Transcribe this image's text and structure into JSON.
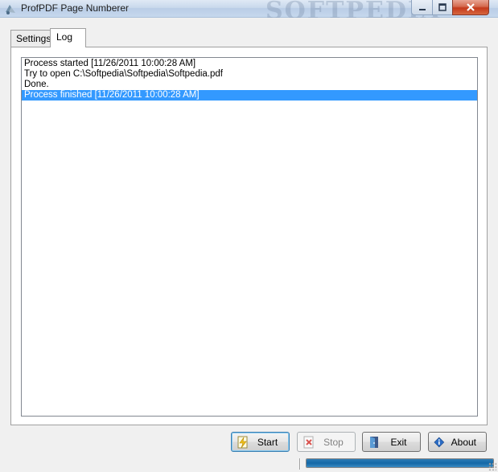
{
  "window": {
    "title": "ProfPDF Page Numberer",
    "watermark": "SOFTPEDIA",
    "minimize_glyph": "▁",
    "maximize_glyph": "☐",
    "close_glyph": "✕"
  },
  "tabs": [
    {
      "label": "Settings",
      "active": false
    },
    {
      "label": "Log",
      "active": true
    }
  ],
  "log": {
    "lines": [
      "Process started [11/26/2011 10:00:28 AM]",
      "Try to open C:\\Softpedia\\Softpedia\\Softpedia.pdf",
      "Done.",
      "Process finished [11/26/2011 10:00:28 AM]"
    ],
    "selected_index": 3
  },
  "buttons": {
    "start": {
      "label": "Start",
      "icon": "start-lightning-icon",
      "enabled": true
    },
    "stop": {
      "label": "Stop",
      "icon": "stop-icon",
      "enabled": false
    },
    "exit": {
      "label": "Exit",
      "icon": "exit-door-icon",
      "enabled": true
    },
    "about": {
      "label": "About",
      "icon": "info-icon",
      "enabled": true
    }
  },
  "status": {
    "progress_percent": 100
  },
  "colors": {
    "selection": "#3399ff",
    "progress": "#1468a6"
  }
}
